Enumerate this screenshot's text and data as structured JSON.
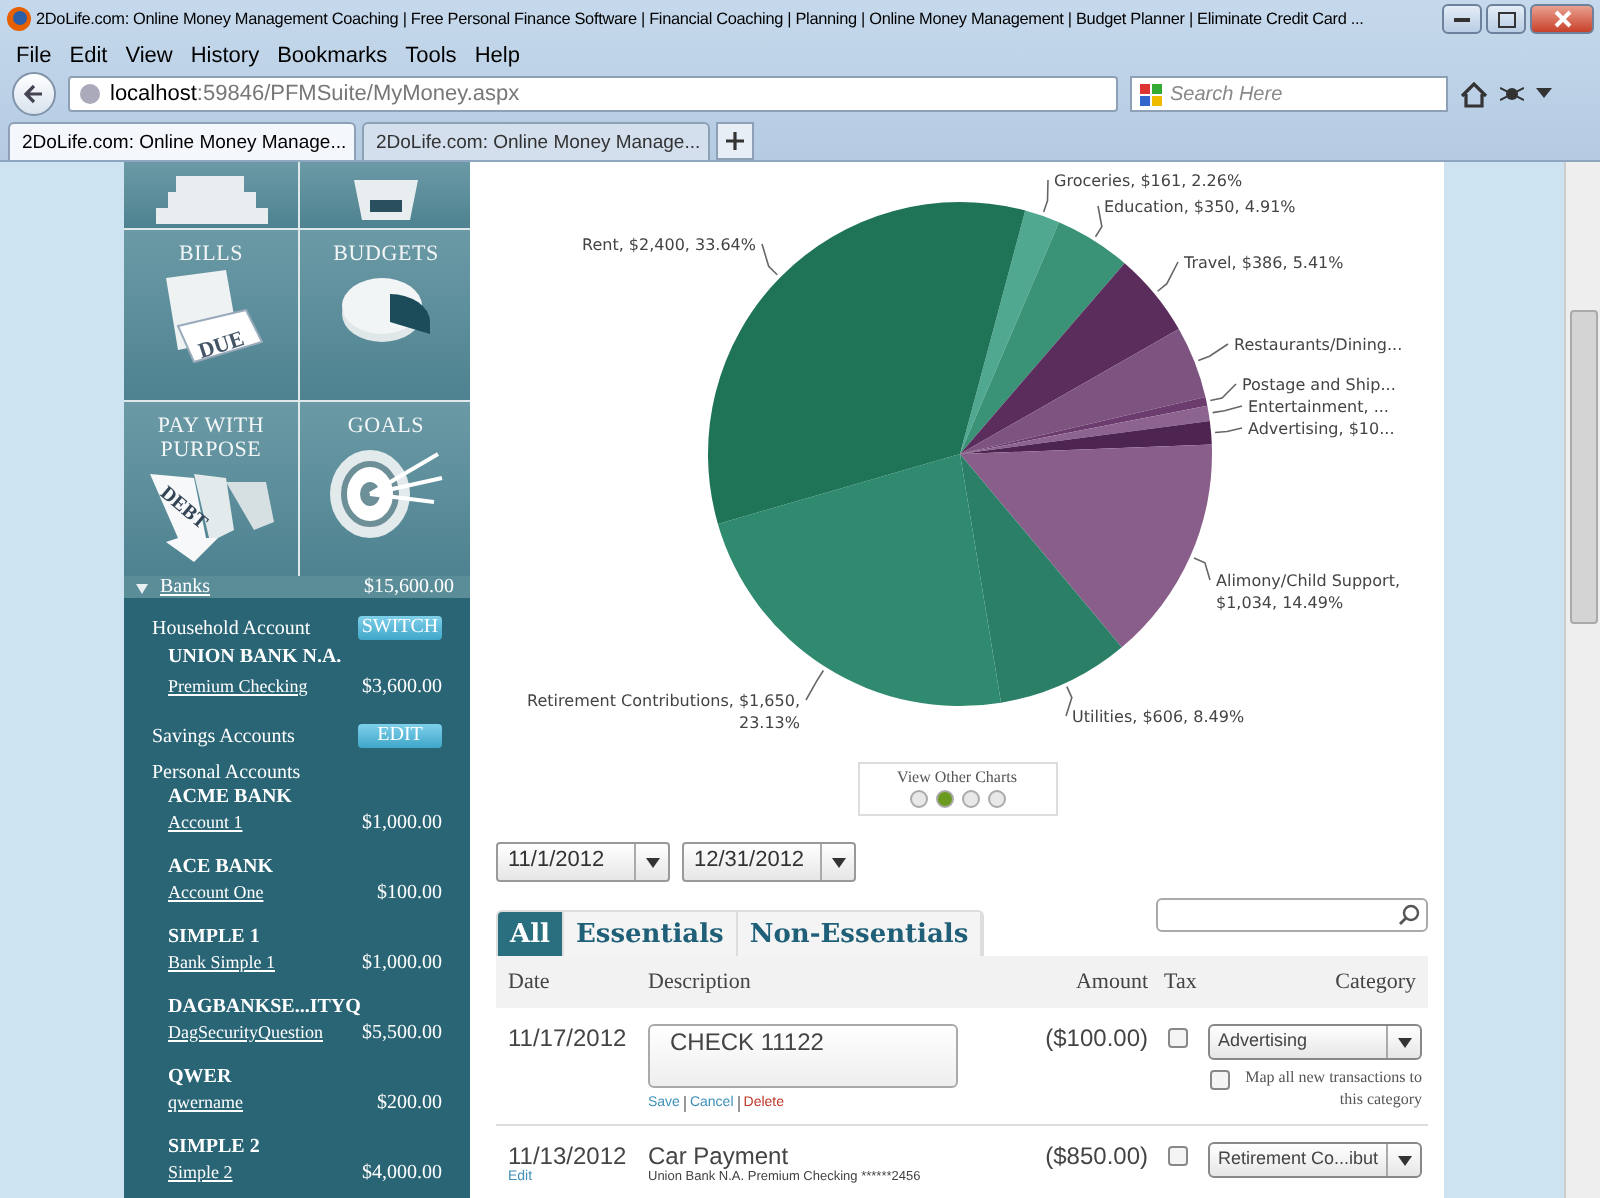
{
  "window": {
    "title": "2DoLife.com: Online Money Management Coaching | Free Personal Finance Software | Financial Coaching | Planning | Online Money Management | Budget Planner | Eliminate Credit Card ..."
  },
  "menu": [
    "File",
    "Edit",
    "View",
    "History",
    "Bookmarks",
    "Tools",
    "Help"
  ],
  "address": {
    "host": "localhost",
    "path": ":59846/PFMSuite/MyMoney.aspx"
  },
  "web_search": {
    "placeholder": "Search Here"
  },
  "browser_tabs": [
    {
      "label": "2DoLife.com: Online Money Manage...",
      "selected": true
    },
    {
      "label": "2DoLife.com: Online Money Manage...",
      "selected": false
    }
  ],
  "tiles": [
    {
      "kind": "building"
    },
    {
      "kind": "card"
    },
    {
      "kind": "bills",
      "label": "BILLS",
      "icon_text": "DUE"
    },
    {
      "kind": "budgets",
      "label": "BUDGETS"
    },
    {
      "kind": "debt",
      "label": "PAY WITH PURPOSE",
      "icon_text": "DEBT"
    },
    {
      "kind": "goals",
      "label": "GOALS"
    }
  ],
  "banks": {
    "label": "Banks",
    "total": "$15,600.00",
    "expanded": true
  },
  "household": {
    "label": "Household Account",
    "button": "SWITCH",
    "bank": "UNION BANK N.A.",
    "account": "Premium Checking",
    "amount": "$3,600.00"
  },
  "savings": {
    "label": "Savings Accounts",
    "button": "EDIT"
  },
  "personal": {
    "label": "Personal Accounts",
    "accounts": [
      {
        "bank": "ACME BANK",
        "account": "Account 1",
        "amount": "$1,000.00"
      },
      {
        "bank": "ACE BANK",
        "account": "Account One",
        "amount": "$100.00"
      },
      {
        "bank": "SIMPLE 1",
        "account": "Bank Simple 1",
        "amount": "$1,000.00"
      },
      {
        "bank": "DAGBANKSE...ITYQ",
        "account": "DagSecurityQuestion",
        "amount": "$5,500.00"
      },
      {
        "bank": "QWER",
        "account": "qwername",
        "amount": "$200.00"
      },
      {
        "bank": "SIMPLE 2",
        "account": "Simple 2",
        "amount": "$4,000.00"
      }
    ]
  },
  "chart": {
    "chart_data": {
      "type": "pie",
      "values": [
        161,
        350,
        386,
        330,
        40,
        70,
        107,
        1034,
        606,
        1650,
        2400
      ],
      "value_labels": [
        "Groceries, $161, 2.26%",
        "Education, $350, 4.91%",
        "Travel, $386, 5.41%",
        "Restaurants/Dining...",
        "Postage and Ship...",
        "Entertainment, ...",
        "Advertising, $10...",
        "Alimony/Child Support,\n$1,034, 14.49%",
        "Utilities, $606, 8.49%",
        "Retirement Contributions, $1,650,\n23.13%",
        "Rent, $2,400, 33.64%"
      ],
      "colors": [
        "#4fa88f",
        "#3a9277",
        "#5b2d5d",
        "#7d5380",
        "#6b3c6d",
        "#8d6490",
        "#4e2551",
        "#8a5e8b",
        "#2a7f66",
        "#308a70",
        "#1f7357"
      ]
    },
    "pager": {
      "title": "View Other Charts",
      "dots": [
        {
          "selected": false
        },
        {
          "selected": true
        },
        {
          "selected": false
        },
        {
          "selected": false
        }
      ]
    }
  },
  "filters": {
    "start": "11/1/2012",
    "end": "12/31/2012"
  },
  "tabs": [
    {
      "label": "All",
      "selected": true
    },
    {
      "label": "Essentials",
      "selected": false
    },
    {
      "label": "Non-Essentials",
      "selected": false
    }
  ],
  "table": {
    "columns": [
      "Date",
      "Description",
      "Amount",
      "Tax",
      "Category"
    ],
    "rows": [
      {
        "kind": "editing",
        "date": "11/17/2012",
        "description": "CHECK 11122",
        "actions": [
          "Save",
          "Cancel",
          "Delete"
        ],
        "amount": "($100.00)",
        "tax": false,
        "category": "Advertising",
        "map_label": "Map all new transactions to this category",
        "map_checked": false
      },
      {
        "kind": "view",
        "date": "11/13/2012",
        "edit": "Edit",
        "description": "Car Payment",
        "account": "Union Bank N.A. Premium Checking ******2456",
        "amount": "($850.00)",
        "tax": false,
        "category": "Retirement Co...ibut"
      }
    ]
  }
}
